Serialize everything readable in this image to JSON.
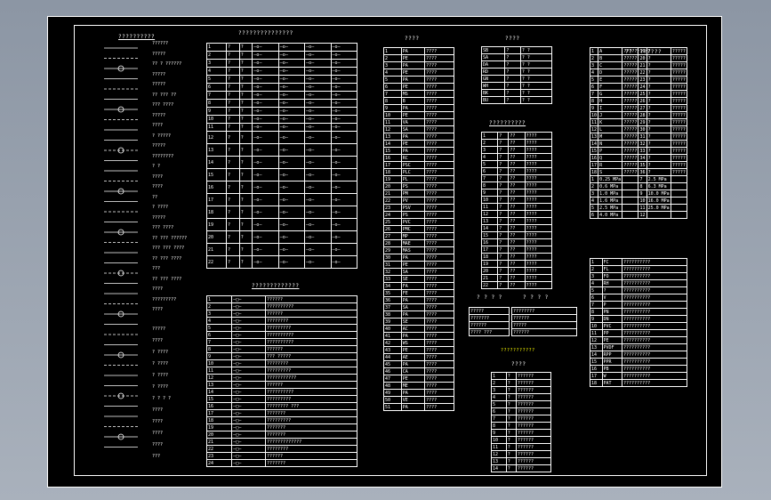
{
  "legend": {
    "title": "??????????",
    "rows": [
      "??????",
      "?????",
      "?? ? ??????",
      "?????",
      "?????",
      "?? ??? ??",
      "??? ????",
      "?????",
      "????",
      "? ?????",
      "?????",
      "????????",
      "? ?",
      "????",
      "????",
      "??",
      "? ????",
      "?????",
      "??? ????",
      "?? ??? ??????",
      "??? ??? ????",
      "?? ??? ????",
      "???",
      "?? ??? ????",
      "????",
      "?????????",
      "????"
    ],
    "rows2": [
      "?????",
      "????",
      "? ????",
      "? ????",
      "? ????",
      "? ????",
      "? ? ? ?",
      "????",
      "????",
      "????",
      "????",
      "???"
    ]
  },
  "sym_table": {
    "title": "???????????????",
    "rows": [
      "1",
      "2",
      "3",
      "4",
      "5",
      "6",
      "7",
      "8",
      "9",
      "10",
      "11",
      "12",
      "13",
      "14",
      "15",
      "16",
      "17",
      "18",
      "19",
      "20",
      "21",
      "22"
    ]
  },
  "sym_table2": {
    "title": "?????????????",
    "rows": [
      "??????",
      "??????????",
      "??????",
      "????????",
      "?????????",
      "??????????",
      "??????????",
      "??????",
      "??? ?????",
      "????????",
      "?????????",
      "???????????",
      "??????",
      "??????????",
      "?????????",
      "???????? ???",
      "???????",
      "?????????",
      "???????",
      "???????",
      "?????????????",
      "????????",
      "??????",
      "???????"
    ]
  },
  "code_table": {
    "title": "????",
    "codes": [
      "PA",
      "PE",
      "PA",
      "PE",
      "PA",
      "PE",
      "MS",
      "B",
      "PA",
      "PE",
      "VA",
      "SA",
      "PA",
      "PE",
      "PA",
      "RC",
      "PSC",
      "PLC",
      "PL",
      "PS",
      "PM",
      "PV",
      "PSV",
      "PS",
      "PVC",
      "PMC",
      "MP",
      "MAE",
      "MAS",
      "PA",
      "PE",
      "SA",
      "SE",
      "FA",
      "FE",
      "PA",
      "SA",
      "PA",
      "SE",
      "AC",
      "PA",
      "WS",
      "PE",
      "AE",
      "PA",
      "CA",
      "PE",
      "ME",
      "PA",
      "VE",
      "PA"
    ]
  },
  "small_table1": {
    "title": "????",
    "codes": [
      "SB",
      "SA",
      "DA",
      "RD",
      "GN",
      "WH",
      "BK",
      "BU"
    ]
  },
  "small_table2": {
    "title": "??????????",
    "cols": [
      "?",
      "???",
      "???"
    ]
  },
  "small_table3": {
    "title": "? ? ? ?",
    "rows": [
      "?????",
      "???????",
      "??????",
      "???? ???"
    ]
  },
  "small_table4": {
    "title": "? ? ? ?",
    "rows": [
      "????????",
      "??????",
      "?????",
      "??????"
    ]
  },
  "small_table5": {
    "title": "????",
    "note": "???????????"
  },
  "right_table1": {
    "title": "?? ???????",
    "letters": [
      "A",
      "B",
      "C",
      "D",
      "E",
      "F",
      "G",
      "H",
      "I",
      "J",
      "K",
      "L",
      "M",
      "N",
      "P",
      "Q",
      "R",
      "S"
    ],
    "pressures": [
      "0.25 MPa",
      "0.6 MPa",
      "1.0 MPa",
      "1.6 MPa",
      "2.5 MPa",
      "4.0 MPa"
    ],
    "pressures2": [
      "2.5 MPa",
      "6.3 MPa",
      "10.0 MPa",
      "16.0 MPa",
      "25.0 MPa"
    ]
  },
  "right_table2": {
    "codes": [
      "FC",
      "FL",
      "FO",
      "RH",
      "?",
      "V",
      "P",
      "PN",
      "DN",
      "PVC",
      "PP",
      "PE",
      "PVDF",
      "RPP",
      "PPR",
      "PB",
      "W",
      "PAT"
    ]
  }
}
